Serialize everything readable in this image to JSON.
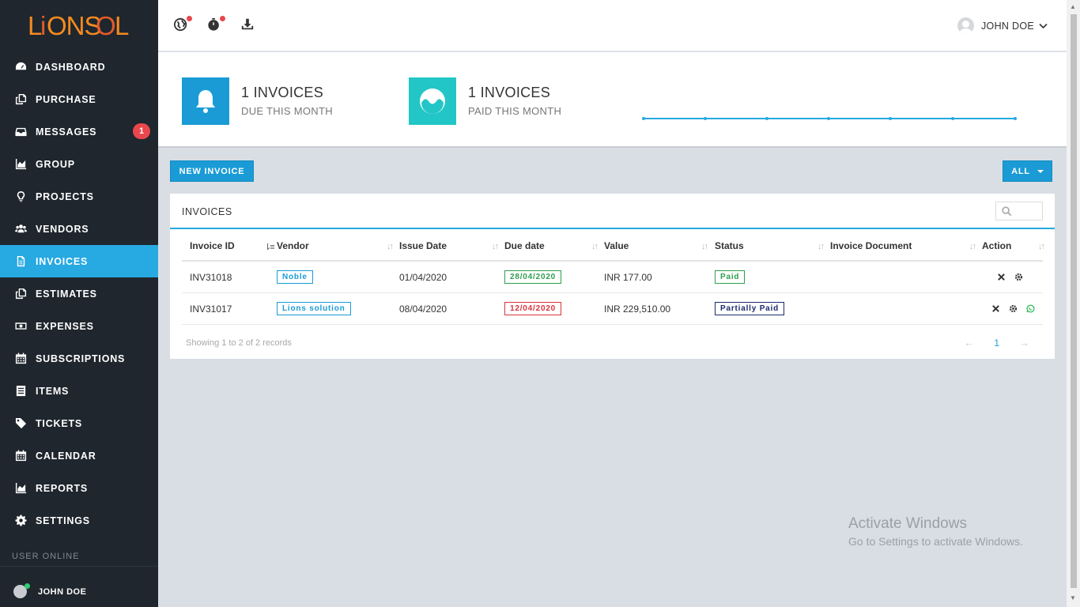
{
  "brand": {
    "logo_text": "LIONSOL"
  },
  "sidebar": {
    "items": [
      {
        "label": "DASHBOARD",
        "icon": "dashboard-icon"
      },
      {
        "label": "PURCHASE",
        "icon": "copy-icon"
      },
      {
        "label": "MESSAGES",
        "icon": "inbox-icon",
        "badge": "1"
      },
      {
        "label": "GROUP",
        "icon": "area-chart-icon"
      },
      {
        "label": "PROJECTS",
        "icon": "lightbulb-icon"
      },
      {
        "label": "VENDORS",
        "icon": "users-icon"
      },
      {
        "label": "INVOICES",
        "icon": "document-icon",
        "active": true
      },
      {
        "label": "ESTIMATES",
        "icon": "copy-icon"
      },
      {
        "label": "EXPENSES",
        "icon": "money-icon"
      },
      {
        "label": "SUBSCRIPTIONS",
        "icon": "calendar-icon"
      },
      {
        "label": "ITEMS",
        "icon": "list-icon"
      },
      {
        "label": "TICKETS",
        "icon": "tag-icon"
      },
      {
        "label": "CALENDAR",
        "icon": "calendar-icon"
      },
      {
        "label": "REPORTS",
        "icon": "area-chart-icon"
      },
      {
        "label": "SETTINGS",
        "icon": "gear-icon"
      }
    ],
    "user_online_heading": "USER ONLINE",
    "online_user": "JOHN DOE"
  },
  "topbar": {
    "user_name": "JOHN DOE"
  },
  "stats": [
    {
      "value": "1 INVOICES",
      "label": "DUE THIS MONTH",
      "color": "#1a9bd6",
      "icon": "bell-icon"
    },
    {
      "value": "1 INVOICES",
      "label": "PAID THIS MONTH",
      "color": "#22c6c6",
      "icon": "wave-icon"
    }
  ],
  "actions": {
    "new_invoice": "NEW INVOICE",
    "filter": "ALL"
  },
  "panel": {
    "title": "INVOICES",
    "search_value": ""
  },
  "table": {
    "headers": [
      "Invoice ID",
      "Vendor",
      "Issue Date",
      "Due date",
      "Value",
      "Status",
      "Invoice Document",
      "Action"
    ],
    "rows": [
      {
        "id": "INV31018",
        "vendor": "Noble",
        "issue_date": "01/04/2020",
        "due_date": "28/04/2020",
        "due_color": "green",
        "value": "INR 177.00",
        "status": "Paid",
        "status_color": "green",
        "document": ""
      },
      {
        "id": "INV31017",
        "vendor": "Lions solution",
        "issue_date": "08/04/2020",
        "due_date": "12/04/2020",
        "due_color": "red",
        "value": "INR 229,510.00",
        "status": "Partially Paid",
        "status_color": "navy",
        "document": ""
      }
    ],
    "footer": "Showing 1 to 2 of 2 records",
    "page": "1"
  },
  "watermark": {
    "line1": "Activate Windows",
    "line2": "Go to Settings to activate Windows."
  }
}
